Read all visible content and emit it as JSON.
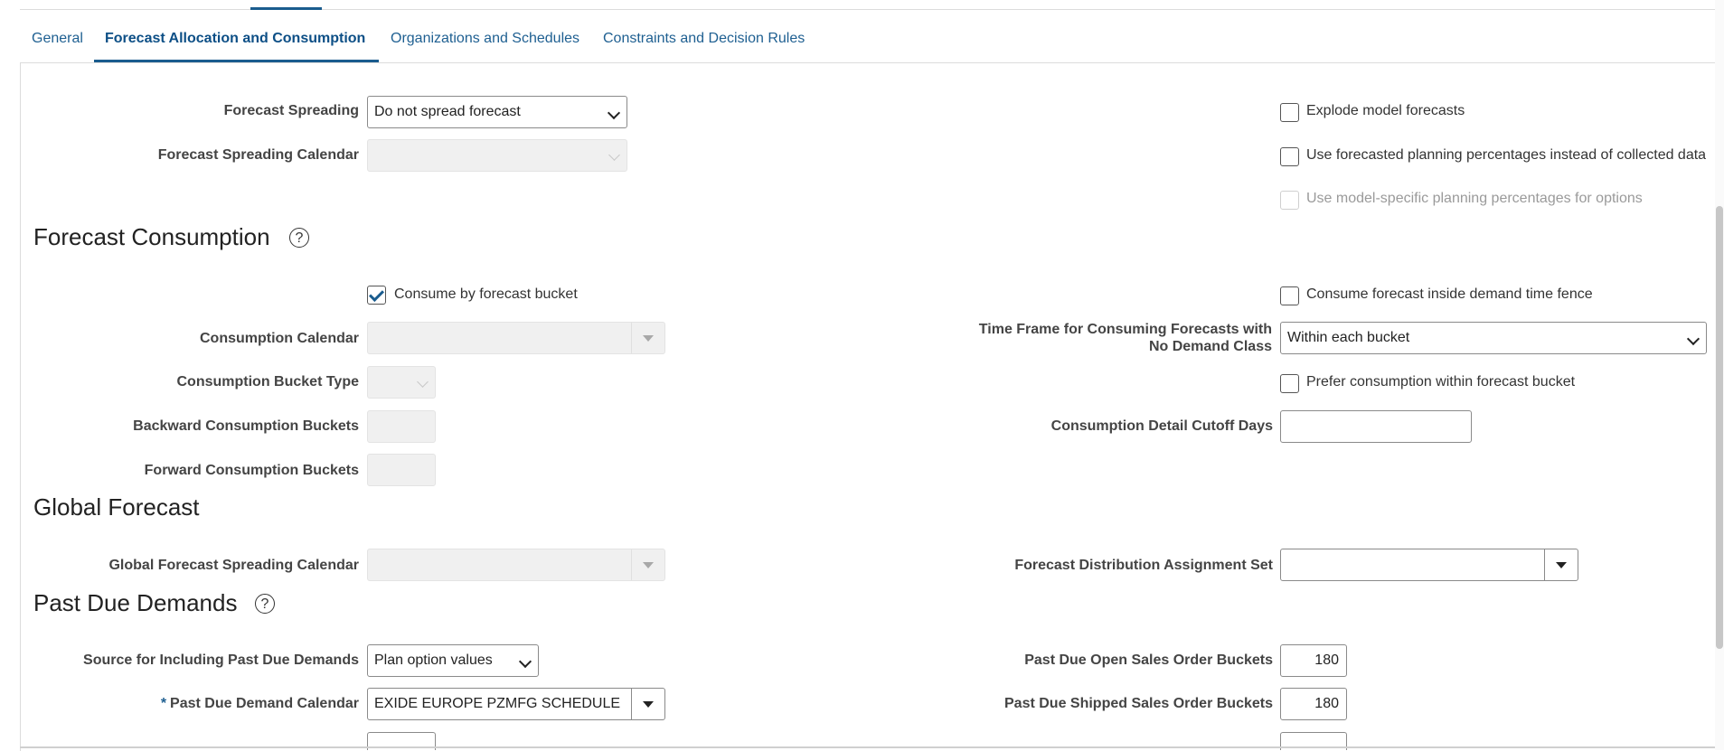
{
  "tabs": [
    {
      "label": "General"
    },
    {
      "label": "Forecast Allocation and Consumption"
    },
    {
      "label": "Organizations and Schedules"
    },
    {
      "label": "Constraints and Decision Rules"
    }
  ],
  "forecast_spreading": {
    "label": "Forecast Spreading",
    "value": "Do not spread forecast",
    "calendar_label": "Forecast Spreading Calendar",
    "calendar_value": ""
  },
  "model_options": {
    "explode_label": "Explode model forecasts",
    "forecasted_pct_label": "Use forecasted planning percentages instead of collected data",
    "model_specific_label": "Use model-specific planning percentages for options"
  },
  "forecast_consumption": {
    "heading": "Forecast Consumption",
    "help_glyph": "?",
    "consume_by_bucket_label": "Consume by forecast bucket",
    "consume_inside_fence_label": "Consume forecast inside demand time fence",
    "consumption_calendar_label": "Consumption Calendar",
    "consumption_calendar_value": "",
    "time_frame_label": "Time Frame for Consuming Forecasts with No Demand Class",
    "time_frame_value": "Within each bucket",
    "bucket_type_label": "Consumption Bucket Type",
    "prefer_within_bucket_label": "Prefer consumption within forecast bucket",
    "backward_label": "Backward Consumption Buckets",
    "detail_cutoff_label": "Consumption Detail Cutoff Days",
    "detail_cutoff_value": "",
    "forward_label": "Forward Consumption Buckets"
  },
  "global_forecast": {
    "heading": "Global Forecast",
    "spreading_calendar_label": "Global Forecast Spreading Calendar",
    "spreading_calendar_value": "",
    "distribution_set_label": "Forecast Distribution Assignment Set",
    "distribution_set_value": ""
  },
  "past_due": {
    "heading": "Past Due Demands",
    "help_glyph": "?",
    "source_label": "Source for Including Past Due Demands",
    "source_value": "Plan option values",
    "open_so_label": "Past Due Open Sales Order Buckets",
    "open_so_value": "180",
    "required_mark": "*",
    "calendar_label": "Past Due Demand Calendar",
    "calendar_value": "EXIDE EUROPE PZMFG SCHEDULE",
    "shipped_so_label": "Past Due Shipped Sales Order Buckets",
    "shipped_so_value": "180"
  },
  "colors": {
    "accent": "#1a5c8e",
    "link": "#1e5f91",
    "disabled_bg": "#f0f0f0",
    "label": "#444444"
  }
}
